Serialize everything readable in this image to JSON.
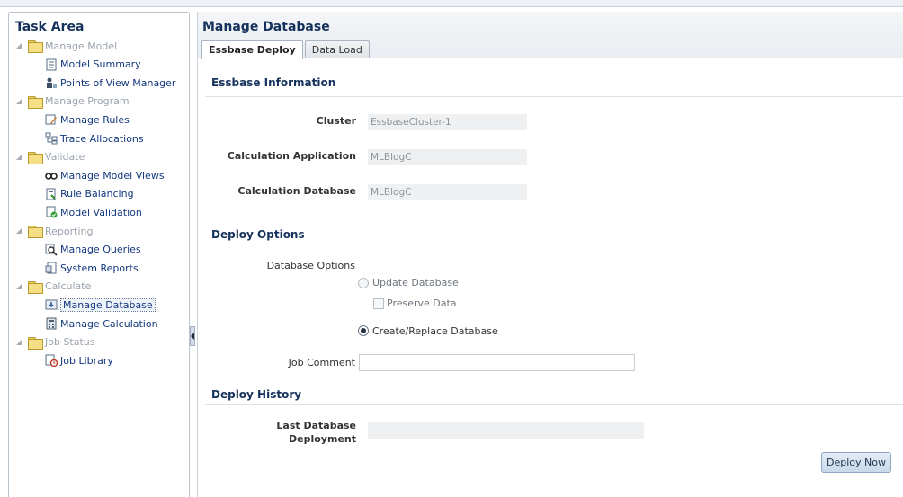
{
  "task_area": {
    "title": "Task Area",
    "categories": [
      {
        "label": "Manage Model",
        "items": [
          {
            "label": "Model Summary",
            "icon": "model-summary-icon"
          },
          {
            "label": "Points of View Manager",
            "icon": "pov-manager-icon"
          }
        ]
      },
      {
        "label": "Manage Program",
        "items": [
          {
            "label": "Manage Rules",
            "icon": "rules-icon"
          },
          {
            "label": "Trace Allocations",
            "icon": "trace-icon"
          }
        ]
      },
      {
        "label": "Validate",
        "items": [
          {
            "label": "Manage Model Views",
            "icon": "model-views-icon"
          },
          {
            "label": "Rule Balancing",
            "icon": "rule-balancing-icon"
          },
          {
            "label": "Model Validation",
            "icon": "model-validation-icon"
          }
        ]
      },
      {
        "label": "Reporting",
        "items": [
          {
            "label": "Manage Queries",
            "icon": "queries-icon"
          },
          {
            "label": "System Reports",
            "icon": "reports-icon"
          }
        ]
      },
      {
        "label": "Calculate",
        "items": [
          {
            "label": "Manage Database",
            "icon": "database-icon",
            "selected": true
          },
          {
            "label": "Manage Calculation",
            "icon": "calculator-icon"
          }
        ]
      },
      {
        "label": "Job Status",
        "items": [
          {
            "label": "Job Library",
            "icon": "job-library-icon"
          }
        ]
      }
    ]
  },
  "main": {
    "title": "Manage Database",
    "tabs": [
      {
        "label": "Essbase Deploy",
        "active": true
      },
      {
        "label": "Data Load",
        "active": false
      }
    ],
    "essbase_info": {
      "heading": "Essbase Information",
      "cluster_label": "Cluster",
      "cluster_value": "EssbaseCluster-1",
      "calc_app_label": "Calculation Application",
      "calc_app_value": "MLBlogC",
      "calc_db_label": "Calculation Database",
      "calc_db_value": "MLBlogC"
    },
    "deploy_options": {
      "heading": "Deploy Options",
      "db_options_label": "Database Options",
      "update_label": "Update Database",
      "preserve_label": "Preserve Data",
      "create_label": "Create/Replace Database",
      "selected_option": "Create/Replace Database",
      "job_comment_label": "Job Comment",
      "job_comment_value": ""
    },
    "deploy_history": {
      "heading": "Deploy History",
      "last_deploy_label_line1": "Last Database",
      "last_deploy_label_line2": "Deployment",
      "last_deploy_value": ""
    },
    "deploy_button": "Deploy Now"
  },
  "colors": {
    "heading": "#16325c",
    "link": "#14387f",
    "category": "#9aa3ad"
  }
}
